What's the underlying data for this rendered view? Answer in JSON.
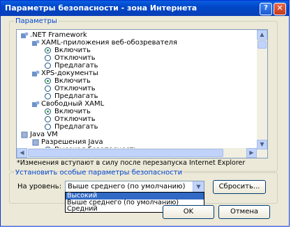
{
  "window": {
    "title": "Параметры безопасности - зона Интернета"
  },
  "settings": {
    "group_label": "Параметры",
    "tree": {
      "net_framework": "NET Framework",
      "xaml_apps": "XAML-приложения веб-обозревателя",
      "xps_docs": "XPS-документы",
      "loose_xaml": "Свободный XAML",
      "enable": "Включить",
      "disable": "Отключить",
      "prompt": "Предлагать",
      "java_vm": "Java VM",
      "java_permissions": "Разрешения Java",
      "high_safety": "Высокая безопасность"
    },
    "note": "*Изменения вступают в силу после перезапуска Internet Explorer"
  },
  "custom": {
    "group_label": "Установить особые параметры безопасности",
    "level_label": "На уровень:",
    "selected": "Выше среднего (по умолчанию)",
    "reset_label": "Сбросить...",
    "options": [
      "Высокий",
      "Выше среднего (по умолчанию)",
      "Средний"
    ]
  },
  "footer": {
    "ok_label": "OK",
    "cancel_label": "Отмена"
  },
  "colors": {
    "title_bar": "#0a5fe0",
    "accent": "#0046d5",
    "selection": "#316ac5",
    "radio_dot": "#21a121"
  }
}
